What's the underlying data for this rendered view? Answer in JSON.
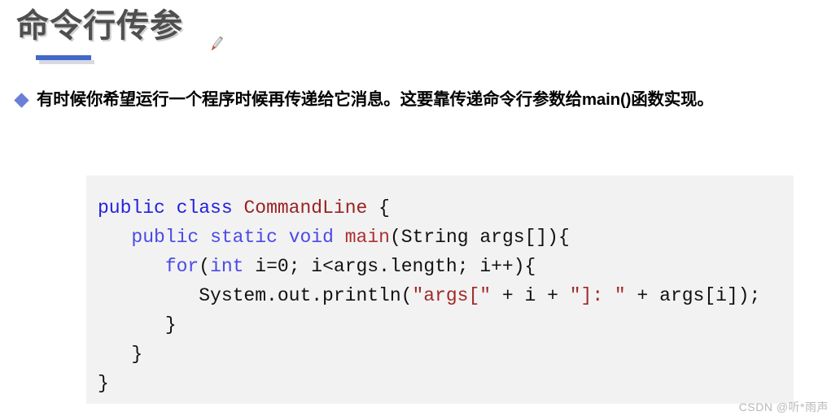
{
  "slide": {
    "title": "命令行传参",
    "pencil_icon": "pencil-icon",
    "bullet_icon": "diamond-bullet-icon",
    "bullet_text": "有时候你希望运行一个程序时候再传递给它消息。这要靠传递命令行参数给main()函数实现。",
    "watermark": "CSDN @听*雨声"
  },
  "colors": {
    "title_text": "#4f4f4f",
    "underline": "#4268c8",
    "underline_shadow": "#d6d9e4",
    "bullet_diamond": "#6b7fd7",
    "code_background": "#f2f2f2",
    "keyword": "#2222dd",
    "classname": "#9b2222",
    "string": "#a02828",
    "plain": "#111111",
    "watermark": "#b9b9b9"
  },
  "code": {
    "language": "java",
    "lines": [
      [
        {
          "t": "public",
          "c": "kw"
        },
        {
          "t": " ",
          "c": "plain"
        },
        {
          "t": "class",
          "c": "kw"
        },
        {
          "t": " ",
          "c": "plain"
        },
        {
          "t": "CommandLine",
          "c": "type"
        },
        {
          "t": " {",
          "c": "plain"
        }
      ],
      [
        {
          "t": "   ",
          "c": "plain"
        },
        {
          "t": "public",
          "c": "kw2"
        },
        {
          "t": " ",
          "c": "plain"
        },
        {
          "t": "static",
          "c": "kw2"
        },
        {
          "t": " ",
          "c": "plain"
        },
        {
          "t": "void",
          "c": "kw2"
        },
        {
          "t": " ",
          "c": "plain"
        },
        {
          "t": "main",
          "c": "fn"
        },
        {
          "t": "(String args[]){",
          "c": "plain"
        }
      ],
      [
        {
          "t": "      ",
          "c": "plain"
        },
        {
          "t": "for",
          "c": "kw2"
        },
        {
          "t": "(",
          "c": "plain"
        },
        {
          "t": "int",
          "c": "kw2"
        },
        {
          "t": " i=0; i<args.length; i++){",
          "c": "plain"
        }
      ],
      [
        {
          "t": "         System.out.println(",
          "c": "plain"
        },
        {
          "t": "\"args[\"",
          "c": "str"
        },
        {
          "t": " + i + ",
          "c": "plain"
        },
        {
          "t": "\"]: \"",
          "c": "str"
        },
        {
          "t": " + args[i]);",
          "c": "plain"
        }
      ],
      [
        {
          "t": "      }",
          "c": "plain"
        }
      ],
      [
        {
          "t": "   }",
          "c": "plain"
        }
      ],
      [
        {
          "t": "}",
          "c": "plain"
        }
      ]
    ]
  }
}
